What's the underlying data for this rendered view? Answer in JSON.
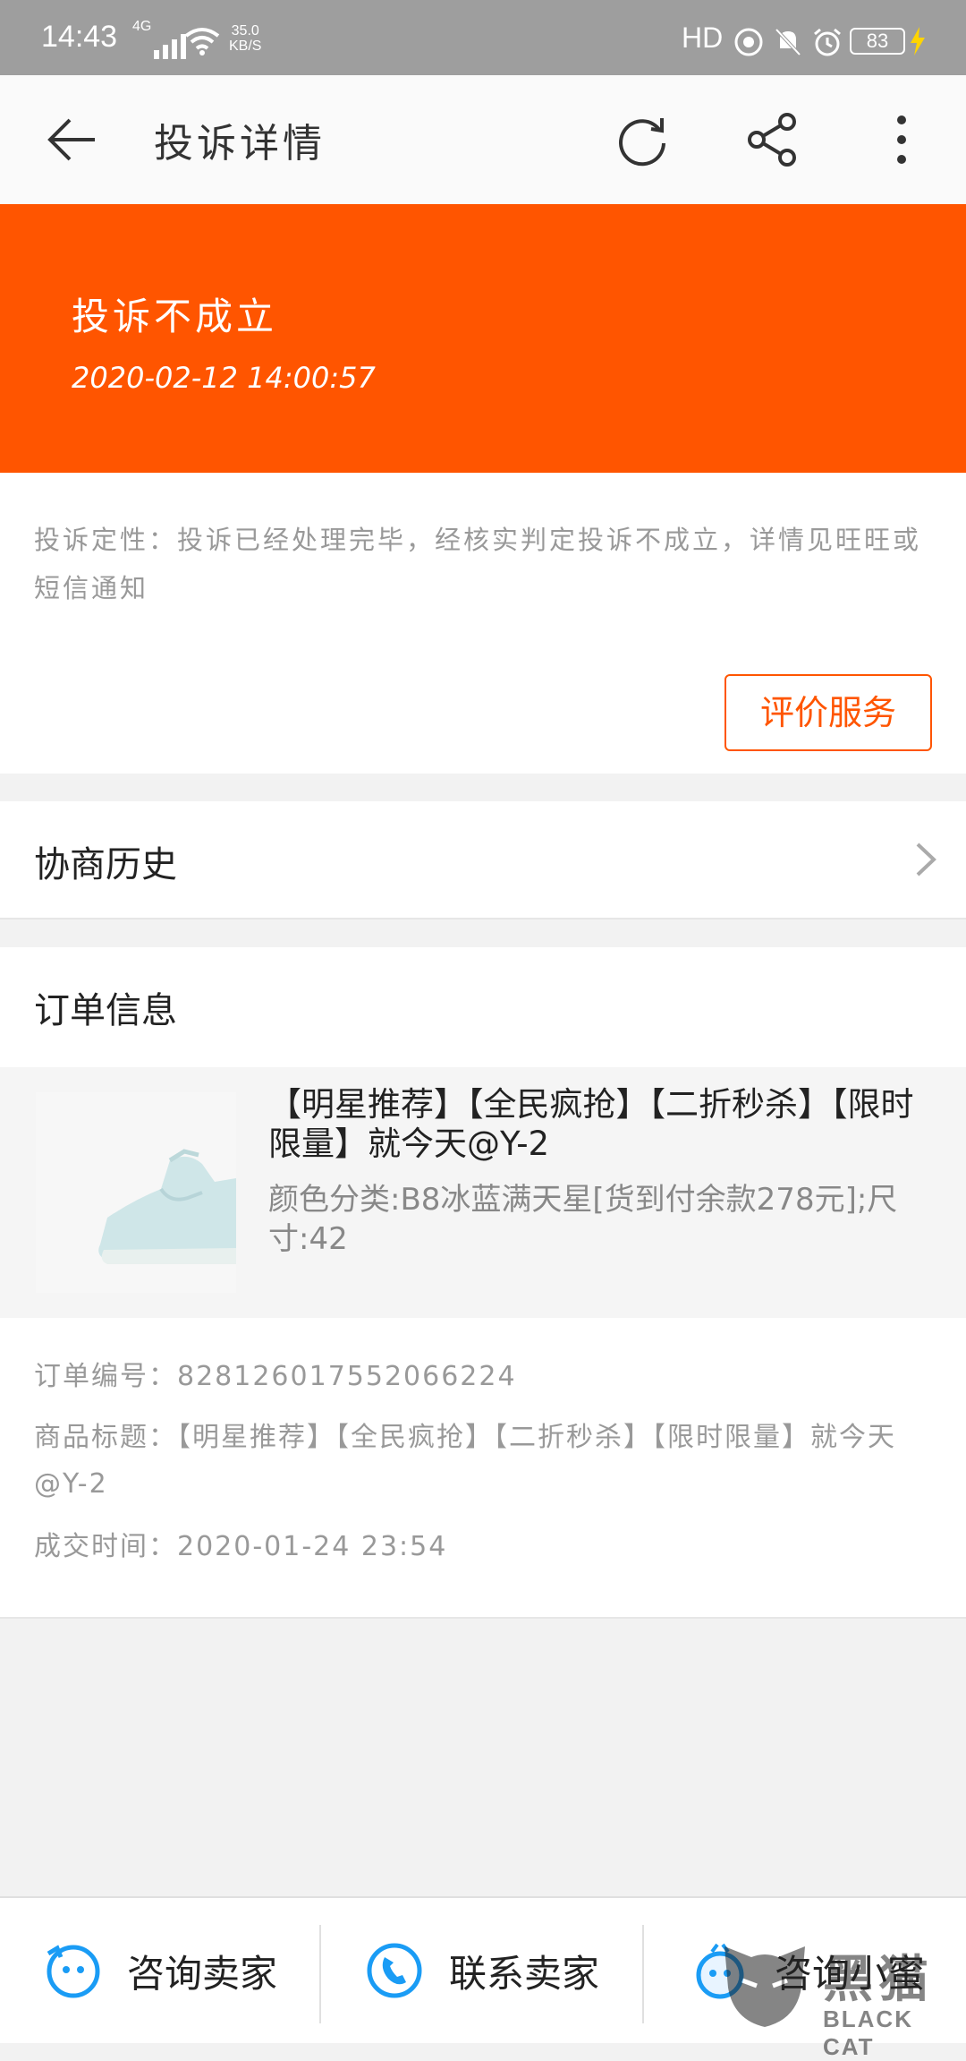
{
  "status_bar": {
    "time": "14:43",
    "network": "4G",
    "speed_value": "35.0",
    "speed_unit": "KB/S",
    "hd": "HD",
    "battery": "83"
  },
  "header": {
    "title": "投诉详情",
    "icons": [
      "back-arrow-icon",
      "refresh-icon",
      "share-icon",
      "more-vertical-icon"
    ]
  },
  "banner": {
    "status": "投诉不成立",
    "time": "2020-02-12 14:00:57",
    "color": "#ff5500"
  },
  "result": {
    "description": "投诉定性：投诉已经处理完毕，经核实判定投诉不成立，详情见旺旺或短信通知",
    "rate_button": "评价服务"
  },
  "history": {
    "label": "协商历史"
  },
  "order": {
    "section_title": "订单信息",
    "product_title": "【明星推荐】【全民疯抢】【二折秒杀】【限时限量】就今天@Y-2",
    "product_spec": "颜色分类:B8冰蓝满天星[货到付余款278元];尺寸:42",
    "order_number_label": "订单编号：",
    "order_number": "828126017552066224",
    "goods_title_label": "商品标题：",
    "goods_title": "【明星推荐】【全民疯抢】【二折秒杀】【限时限量】就今天@Y-2",
    "deal_time_label": "成交时间：",
    "deal_time": "2020-01-24 23:54"
  },
  "bottom_bar": {
    "consult_seller": "咨询卖家",
    "contact_seller": "联系卖家",
    "consult_assistant": "咨询小蜜"
  },
  "watermark": {
    "text": "黑猫",
    "sub": "BLACK CAT"
  }
}
